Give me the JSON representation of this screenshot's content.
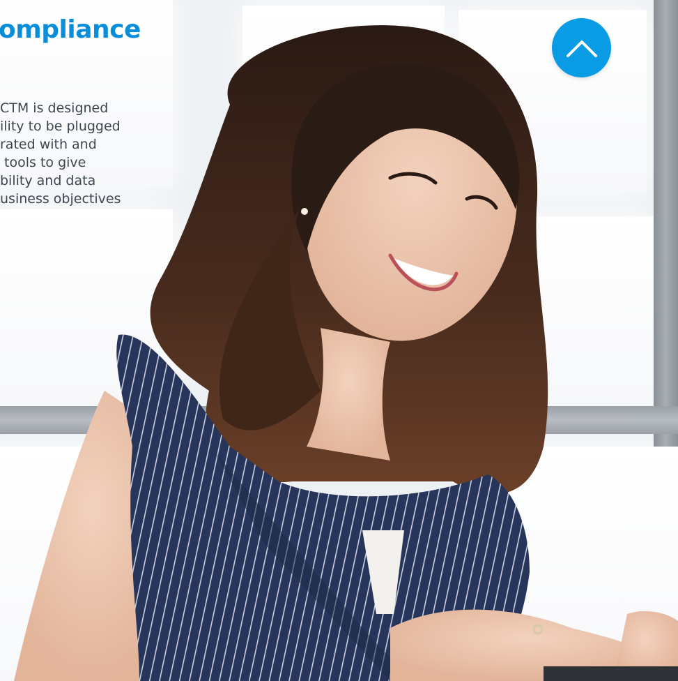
{
  "section": {
    "title": "ompliance",
    "body_lines": [
      "CTM is designed",
      "ility to be plugged",
      "rated with and",
      " tools to give",
      "bility and data",
      "usiness objectives"
    ]
  },
  "scroll_top_button": {
    "icon": "chevron-up-icon",
    "color": "#0a9be5"
  },
  "colors": {
    "heading": "#0b8ed9",
    "text": "#3d4650"
  }
}
